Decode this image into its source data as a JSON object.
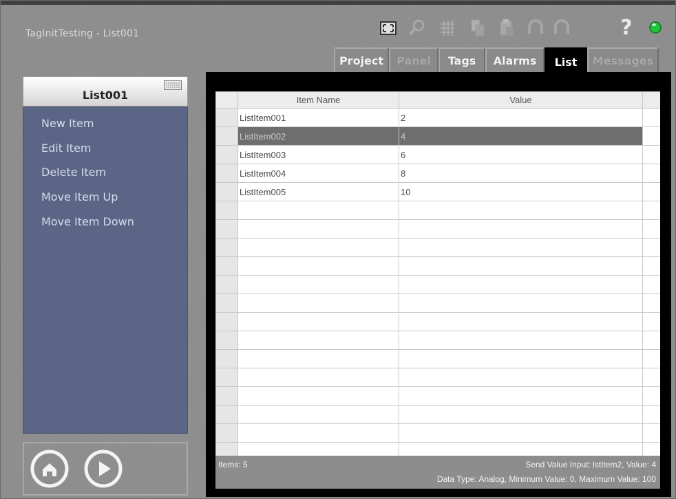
{
  "app": {
    "title": "TagInitTesting - List001"
  },
  "toolbar": {
    "icons": [
      "fullscreen-icon",
      "search-icon",
      "grid-icon",
      "copy-icon",
      "paste-icon",
      "undo-icon",
      "redo-icon",
      "help-icon",
      "status-led-icon"
    ],
    "help_label": "?",
    "status_color": "#22c23a"
  },
  "tabs": [
    {
      "label": "Project",
      "state": "normal"
    },
    {
      "label": "Panel",
      "state": "disabled"
    },
    {
      "label": "Tags",
      "state": "normal"
    },
    {
      "label": "Alarms",
      "state": "normal"
    },
    {
      "label": "List",
      "state": "active"
    },
    {
      "label": "Messages",
      "state": "disabled"
    }
  ],
  "sidebar": {
    "title": "List001",
    "items": [
      {
        "label": "New Item"
      },
      {
        "label": "Edit Item"
      },
      {
        "label": "Delete Item"
      },
      {
        "label": "Move Item Up"
      },
      {
        "label": "Move Item Down"
      }
    ]
  },
  "controls": {
    "home_icon": "home-icon",
    "play_icon": "play-icon"
  },
  "list": {
    "columns": [
      "Item Name",
      "Value"
    ],
    "rows": [
      {
        "name": "ListItem001",
        "value": "2"
      },
      {
        "name": "ListItem002",
        "value": "4",
        "selected": true
      },
      {
        "name": "ListItem003",
        "value": "6"
      },
      {
        "name": "ListItem004",
        "value": "8"
      },
      {
        "name": "ListItem005",
        "value": "10"
      }
    ]
  },
  "status": {
    "items": "Items: 5",
    "line1": "Send Value Input: lstItem2,   Value: 4",
    "line2": "Data Type: Analog,   Minimum Value: 0,   Maximum Value: 100"
  },
  "colors": {
    "menu_bg": "#5b6686",
    "selection": "#6e6e6e",
    "frame": "#8e8e8e"
  }
}
